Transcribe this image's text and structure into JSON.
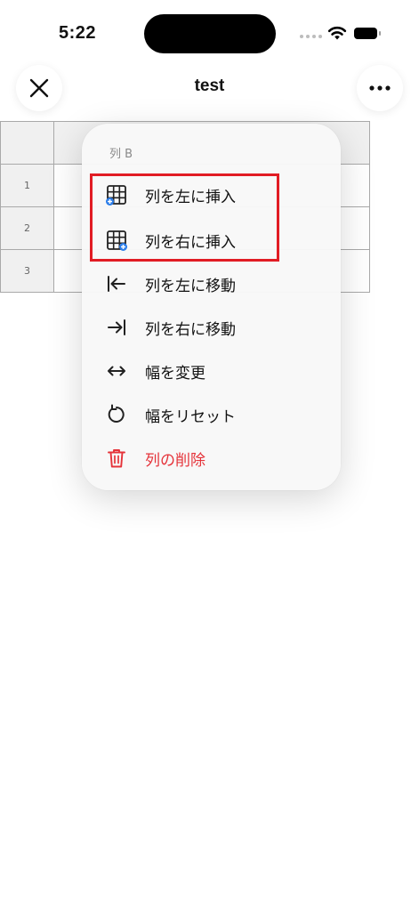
{
  "status_bar": {
    "time": "5:22"
  },
  "header": {
    "title": "test",
    "close_icon": "close-icon",
    "more_icon": "more-icon"
  },
  "sheet": {
    "rows": [
      {
        "label": "1"
      },
      {
        "label": "2"
      },
      {
        "label": "3"
      }
    ]
  },
  "menu": {
    "title": "列 B",
    "items": [
      {
        "label": "列を左に挿入",
        "icon": "insert-column-left-icon"
      },
      {
        "label": "列を右に挿入",
        "icon": "insert-column-right-icon"
      },
      {
        "label": "列を左に移動",
        "icon": "move-left-icon"
      },
      {
        "label": "列を右に移動",
        "icon": "move-right-icon"
      },
      {
        "label": "幅を変更",
        "icon": "resize-width-icon"
      },
      {
        "label": "幅をリセット",
        "icon": "reset-icon"
      },
      {
        "label": "列の削除",
        "icon": "trash-icon"
      }
    ]
  },
  "colors": {
    "danger": "#e5333a",
    "accent": "#2b7de9",
    "highlight": "#e11c24"
  }
}
